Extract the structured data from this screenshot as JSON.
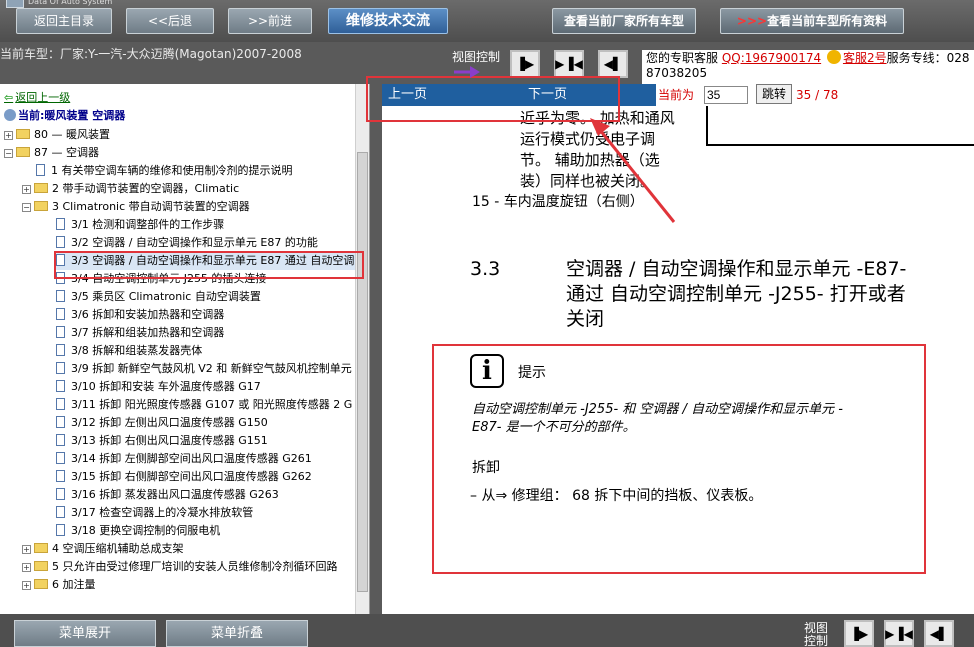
{
  "header": {
    "brand_text": "Data Of Auto System",
    "buttons": {
      "home": "返回主目录",
      "back": "<<后退",
      "forward": ">>前进",
      "forum": "维修技术交流",
      "all_models": "查看当前厂家所有车型",
      "all_docs_arrows": ">>>",
      "all_docs": "查看当前车型所有资料"
    }
  },
  "toolbar": {
    "current_model": "当前车型：厂家:Y-一汽-大众迈腾(Magotan)2007-2008",
    "view_control": "视图控制"
  },
  "support": {
    "prefix": "您的专职客服",
    "qq": "QQ:1967900174",
    "service2": "客服2号",
    "hotline": "服务专线：028",
    "hotline_cont": "87038205"
  },
  "tree": {
    "up_link": "返回上一级",
    "current": "当前:暖风装置 空调器",
    "items": [
      {
        "label": "80 — 暖风装置"
      },
      {
        "label": "87 — 空调器"
      },
      {
        "label": "1 有关带空调车辆的维修和使用制冷剂的提示说明"
      },
      {
        "label": "2 带手动调节装置的空调器，Climatic"
      },
      {
        "label": "3 Climatronic 带自动调节装置的空调器"
      },
      {
        "label": "3/1 检测和调整部件的工作步骤"
      },
      {
        "label": "3/2 空调器 / 自动空调操作和显示单元 E87 的功能"
      },
      {
        "label": "3/3 空调器 / 自动空调操作和显示单元 E87 通过 自动空调"
      },
      {
        "label": "3/4 自动空调控制单元 J255 的插头连接"
      },
      {
        "label": "3/5 乘员区 Climatronic 自动空调装置"
      },
      {
        "label": "3/6 拆卸和安装加热器和空调器"
      },
      {
        "label": "3/7 拆解和组装加热器和空调器"
      },
      {
        "label": "3/8 拆解和组装蒸发器壳体"
      },
      {
        "label": "3/9 拆卸 新鲜空气鼓风机 V2 和 新鲜空气鼓风机控制单元"
      },
      {
        "label": "3/10 拆卸和安装 车外温度传感器 G17"
      },
      {
        "label": "3/11 拆卸 阳光照度传感器 G107 或 阳光照度传感器 2 G"
      },
      {
        "label": "3/12 拆卸 左侧出风口温度传感器 G150"
      },
      {
        "label": "3/13 拆卸 右侧出风口温度传感器 G151"
      },
      {
        "label": "3/14 拆卸 左侧脚部空间出风口温度传感器 G261"
      },
      {
        "label": "3/15 拆卸 右侧脚部空间出风口温度传感器 G262"
      },
      {
        "label": "3/16 拆卸 蒸发器出风口温度传感器 G263"
      },
      {
        "label": "3/17 检查空调器上的冷凝水排放软管"
      },
      {
        "label": "3/18 更换空调控制的伺服电机"
      },
      {
        "label": "4 空调压缩机辅助总成支架"
      },
      {
        "label": "5 只允许由受过修理厂培训的安装人员维修制冷剂循环回路"
      },
      {
        "label": "6 加注量"
      }
    ]
  },
  "nav": {
    "prev": "上一页",
    "next": "下一页",
    "current_label": "当前为",
    "page_value": "35",
    "jump": "跳转",
    "page_count": "35 / 78"
  },
  "doc": {
    "line1": "近乎为零。 加热和通风",
    "line2": "运行模式仍受电子调",
    "line3": "节。 辅助加热器（选",
    "line4": "装）同样也被关闭。",
    "item15": "15 - 车内温度旋钮（右侧）",
    "section_no": "3.3",
    "heading1": "空调器 / 自动空调操作和显示单元 -E87-",
    "heading2": "通过 自动空调控制单元 -J255- 打开或者",
    "heading3": "关闭",
    "note_icon": "i",
    "note_title": "提示",
    "note_text1": "自动空调控制单元 -J255- 和 空调器 / 自动空调操作和显示单元 -",
    "note_text2": "E87- 是一个不可分的部件。",
    "remove_title": "拆卸",
    "remove_step": "–  从⇒  修理组：  68 拆下中间的挡板、仪表板。"
  },
  "bottom": {
    "expand": "菜单展开",
    "collapse": "菜单折叠",
    "view_control_1": "视图",
    "view_control_2": "控制"
  },
  "colors": {
    "highlight": "#e0343a",
    "nav_bar": "#1f5f9f",
    "page_text": "#d40000"
  }
}
